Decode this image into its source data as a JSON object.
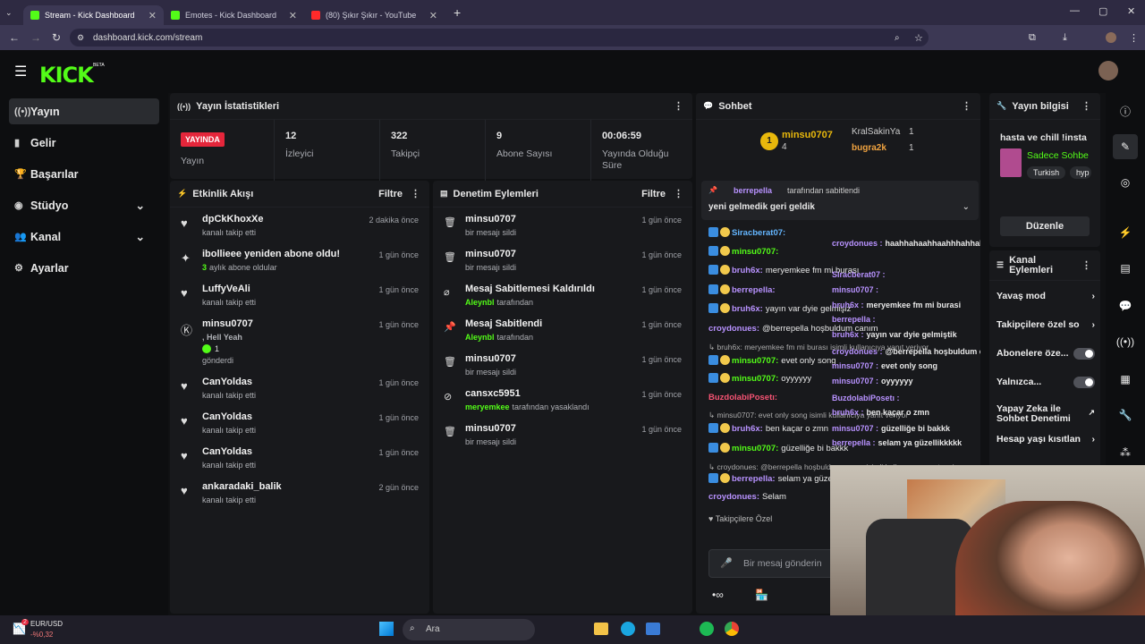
{
  "browser": {
    "tabs": [
      {
        "title": "Stream - Kick Dashboard",
        "fav": "#53fc18"
      },
      {
        "title": "Emotes - Kick Dashboard",
        "fav": "#53fc18"
      },
      {
        "title": "(80) Şıkır Şıkır - YouTube",
        "fav": "#ff2a2a"
      }
    ],
    "url": "dashboard.kick.com/stream",
    "new_tab": "+"
  },
  "brand": {
    "logo": "KICK",
    "beta": "BETA",
    "accent": "#53fc18"
  },
  "sidebar": {
    "items": [
      {
        "label": "Yayın",
        "icon": "broadcast-icon",
        "ic": "((•))"
      },
      {
        "label": "Gelir",
        "icon": "revenue-icon",
        "ic": "▮"
      },
      {
        "label": "Başarılar",
        "icon": "trophy-icon",
        "ic": "🏆"
      },
      {
        "label": "Stüdyo",
        "icon": "studio-icon",
        "ic": "◉"
      },
      {
        "label": "Kanal",
        "icon": "channel-icon",
        "ic": "👥"
      },
      {
        "label": "Ayarlar",
        "icon": "settings-icon",
        "ic": "⚙"
      }
    ]
  },
  "stats": {
    "title": "Yayın İstatistikleri",
    "live_badge": "YAYINDA",
    "items": [
      {
        "value": "",
        "label": "Yayın"
      },
      {
        "value": "12",
        "label": "İzleyici"
      },
      {
        "value": "322",
        "label": "Takipçi"
      },
      {
        "value": "9",
        "label": "Abone Sayısı"
      },
      {
        "value": "00:06:59",
        "label": "Yayında Olduğu Süre"
      }
    ]
  },
  "activity": {
    "title": "Etkinlik Akışı",
    "filter": "Filtre",
    "rows": [
      {
        "name": "dpCkKhoxXe",
        "sub": "kanalı takip etti",
        "time": "2 dakika önce",
        "ic": "♥"
      },
      {
        "name": "ibollieee yeniden abone oldu!",
        "sub": "aylık abone oldular",
        "subnum": "3",
        "time": "1 gün önce",
        "ic": "✦"
      },
      {
        "name": "LuffyVeAli",
        "sub": "kanalı takip etti",
        "time": "1 gün önce",
        "ic": "♥"
      },
      {
        "name": "minsu0707",
        "sub": ", Hell Yeah",
        "sub2": "1",
        "sub3": "gönderdi",
        "time": "1 gün önce",
        "ic": "Ⓚ"
      },
      {
        "name": "CanYoldas",
        "sub": "kanalı takip etti",
        "time": "1 gün önce",
        "ic": "♥"
      },
      {
        "name": "CanYoldas",
        "sub": "kanalı takip etti",
        "time": "1 gün önce",
        "ic": "♥"
      },
      {
        "name": "CanYoldas",
        "sub": "kanalı takip etti",
        "time": "1 gün önce",
        "ic": "♥"
      },
      {
        "name": "ankaradaki_balik",
        "sub": "kanalı takip etti",
        "time": "2 gün önce",
        "ic": "♥"
      }
    ]
  },
  "moderation": {
    "title": "Denetim Eylemleri",
    "filter": "Filtre",
    "rows": [
      {
        "name": "minsu0707",
        "sub": "bir mesajı sildi",
        "time": "1 gün önce",
        "ic": "🗑"
      },
      {
        "name": "minsu0707",
        "sub": "bir mesajı sildi",
        "time": "1 gün önce",
        "ic": "🗑"
      },
      {
        "name": "Mesaj Sabitlemesi Kaldırıldı",
        "actor": "Aleynbl",
        "sub": "tarafından",
        "time": "1 gün önce",
        "ic": "⌀"
      },
      {
        "name": "Mesaj Sabitlendi",
        "actor": "Aleynbl",
        "sub": "tarafından",
        "time": "1 gün önce",
        "ic": "📌"
      },
      {
        "name": "minsu0707",
        "sub": "bir mesajı sildi",
        "time": "1 gün önce",
        "ic": "🗑"
      },
      {
        "name": "cansxc5951",
        "actor": "meryemkee",
        "sub": "tarafından yasaklandı",
        "time": "1 gün önce",
        "ic": "⊘"
      },
      {
        "name": "minsu0707",
        "sub": "bir mesajı sildi",
        "time": "1 gün önce",
        "ic": "🗑"
      }
    ]
  },
  "chat": {
    "title": "Sohbet",
    "leader": {
      "name": "minsu0707",
      "count": "4",
      "rank": "1"
    },
    "top2": [
      {
        "name": "KralSakinYa",
        "count": "1"
      },
      {
        "name": "bugra2k",
        "count": "1"
      }
    ],
    "pinned": {
      "by": "berrepella",
      "by_suffix": "tarafından sabitlendi",
      "text": "yeni gelmedik geri geldik"
    },
    "messages": [
      {
        "user": "Siracberat07:",
        "text": "",
        "cls": "u4"
      },
      {
        "user": "minsu0707:",
        "text": "",
        "cls": "u2"
      },
      {
        "user": "bruh6x:",
        "text": "meryemkee fm mi burası",
        "cls": "u1"
      },
      {
        "user": "berrepella:",
        "text": "",
        "cls": "u1"
      },
      {
        "user": "bruh6x:",
        "text": "yayın var dyie gelmişiz",
        "cls": "u1"
      },
      {
        "user": "croydonues:",
        "text": "@berrepella hoşbuldum canım",
        "cls": "u1"
      },
      {
        "user": "↳ bruh6x: meryemkee fm mi burası isimli kullanıcıya yanıt veriyor",
        "text": "",
        "cls": "u5"
      },
      {
        "user": "minsu0707:",
        "text": "evet only song",
        "cls": "u2"
      },
      {
        "user": "minsu0707:",
        "text": "oyyyyyy",
        "cls": "u2"
      },
      {
        "user": "BuzdolabiPosetı:",
        "text": "",
        "cls": "u3"
      },
      {
        "user": "↳ minsu0707: evet only song isimli kullanıcıya yanıt veriyor",
        "text": "",
        "cls": "u5"
      },
      {
        "user": "bruh6x:",
        "text": "ben kaçar o zmn",
        "cls": "u1"
      },
      {
        "user": "minsu0707:",
        "text": "güzelliğe bi bakkk",
        "cls": "u2"
      },
      {
        "user": "↳ croydonues: @berrepella hoşbuldum canım isimli kullanıcıya yanıt veriyor",
        "text": "",
        "cls": "u5"
      },
      {
        "user": "berrepella:",
        "text": "selam ya güzel",
        "cls": "u1"
      },
      {
        "user": "croydonues:",
        "text": "Selam",
        "cls": "u1"
      }
    ],
    "overlay": [
      {
        "user": "croydonues :",
        "text": "haahhahaahhaahhhahhahaha"
      },
      {
        "user": "Siracberat07 :",
        "text": ""
      },
      {
        "user": "minsu0707 :",
        "text": ""
      },
      {
        "user": "bruh6x :",
        "text": "meryemkee fm mi burasi"
      },
      {
        "user": "berrepella :",
        "text": ""
      },
      {
        "user": "bruh6x :",
        "text": "yayın var dyie gelmiştik"
      },
      {
        "user": "croydonues :",
        "text": "@berrepella hoşbuldum canım"
      },
      {
        "user": "minsu0707 :",
        "text": "evet only song"
      },
      {
        "user": "minsu0707 :",
        "text": "oyyyyyy"
      },
      {
        "user": "BuzdolabiPosetı :",
        "text": ""
      },
      {
        "user": "bruh6x :",
        "text": "ben kaçar o zmn"
      },
      {
        "user": "minsu0707 :",
        "text": "güzelliğe bi bakkk"
      },
      {
        "user": "berrepella :",
        "text": "selam ya güzellikkkkk"
      }
    ],
    "followers_only": "Takipçilere Özel",
    "input_placeholder": "Bir mesaj gönderin"
  },
  "info": {
    "title": "Yayın bilgisi",
    "stream_title": "hasta ve chill !insta",
    "category": "Sadece Sohbe",
    "tags": [
      "Turkish",
      "hyp"
    ],
    "edit": "Düzenle"
  },
  "actions": {
    "title": "Kanal Eylemleri",
    "items": [
      {
        "label": "Yavaş mod",
        "type": "chev"
      },
      {
        "label": "Takipçilere özel so",
        "type": "chev"
      },
      {
        "label": "Abonelere öze...",
        "type": "toggle"
      },
      {
        "label": "Yalnızca...",
        "type": "toggle"
      },
      {
        "label": "Yapay Zeka ile Sohbet Denetimi",
        "type": "ext"
      },
      {
        "label": "Hesap yaşı kısıtlan",
        "type": "chev"
      }
    ]
  },
  "taskbar": {
    "ticker": "EUR/USD",
    "change": "-%0,32",
    "search": "Ara",
    "notif": "2"
  }
}
